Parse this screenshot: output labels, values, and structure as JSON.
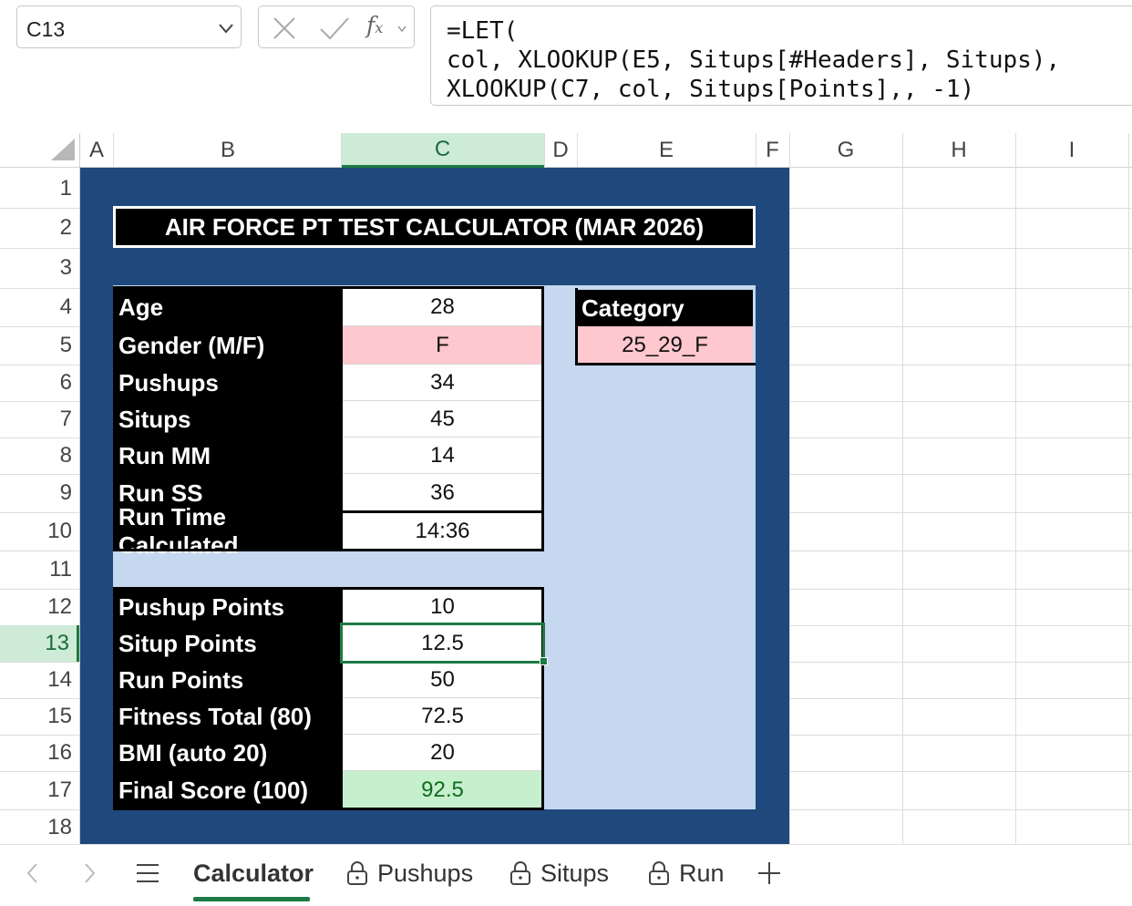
{
  "formula_bar": {
    "name_box": "C13",
    "fx_label": "f",
    "fx_sub": "x",
    "formula_lines": [
      "=LET(",
      "col, XLOOKUP(E5, Situps[#Headers], Situps),",
      "XLOOKUP(C7, col, Situps[Points],, -1)"
    ]
  },
  "columns": [
    "A",
    "B",
    "C",
    "D",
    "E",
    "F",
    "G",
    "H",
    "I"
  ],
  "selected_column": "C",
  "rows": [
    "1",
    "2",
    "3",
    "4",
    "5",
    "6",
    "7",
    "8",
    "9",
    "10",
    "11",
    "12",
    "13",
    "14",
    "15",
    "16",
    "17",
    "18"
  ],
  "selected_row": "13",
  "calculator": {
    "title": "AIR FORCE PT TEST CALCULATOR (MAR 2026)",
    "inputs": [
      {
        "label": "Age",
        "value": "28"
      },
      {
        "label": "Gender (M/F)",
        "value": "F"
      },
      {
        "label": "Pushups",
        "value": "34"
      },
      {
        "label": "Situps",
        "value": "45"
      },
      {
        "label": "Run MM",
        "value": "14"
      },
      {
        "label": "Run SS",
        "value": "36"
      },
      {
        "label": "Run Time Calculated",
        "value": "14:36"
      }
    ],
    "results": [
      {
        "label": "Pushup Points",
        "value": "10"
      },
      {
        "label": "Situp Points",
        "value": "12.5"
      },
      {
        "label": "Run Points",
        "value": "50"
      },
      {
        "label": "Fitness Total (80)",
        "value": "72.5"
      },
      {
        "label": "BMI (auto 20)",
        "value": "20"
      },
      {
        "label": "Final Score (100)",
        "value": "92.5"
      }
    ],
    "category": {
      "label": "Category",
      "value": "25_29_F"
    }
  },
  "colors": {
    "navy_panel": "#1f497d",
    "light_blue_panel": "#c5d8ef",
    "input_pink": "#ffc7ce",
    "result_green": "#c6efce",
    "excel_green": "#1d7a44"
  },
  "sheet_tabs": {
    "tabs": [
      {
        "label": "Calculator",
        "active": true,
        "locked": false
      },
      {
        "label": "Pushups",
        "active": false,
        "locked": true
      },
      {
        "label": "Situps",
        "active": false,
        "locked": true
      },
      {
        "label": "Run",
        "active": false,
        "locked": true
      }
    ],
    "icons": [
      "chevron-left-icon",
      "chevron-right-icon",
      "menu-icon",
      "lock-icon",
      "plus-icon"
    ]
  }
}
